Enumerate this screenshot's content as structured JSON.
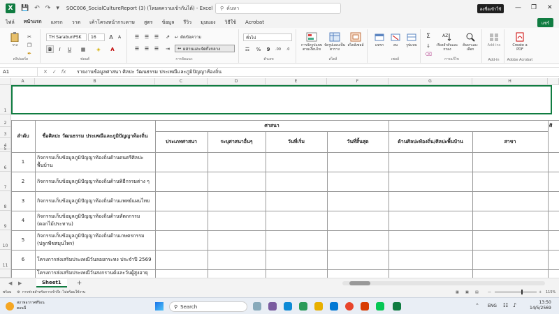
{
  "titlebar": {
    "autosave_label": "",
    "doc_title": "SOC006_SocialCultureReport (3) (โหมดความเข้ากันได้) - Excel",
    "search_placeholder": "ค้นหา",
    "signin_label": "ลงชื่อเข้าใช้"
  },
  "tabs": [
    "ไฟล์",
    "หน้าแรก",
    "แทรก",
    "วาด",
    "เค้าโครงหน้ากระดาษ",
    "สูตร",
    "ข้อมูล",
    "รีวิว",
    "มุมมอง",
    "วิธีใช้",
    "Acrobat"
  ],
  "active_tab": "หน้าแรก",
  "share_label": "แชร์",
  "ribbon": {
    "paste_label": "วาง",
    "clipboard_label": "คลิปบอร์ด",
    "font_name": "TH SarabunPSK",
    "font_size": "16",
    "font_group_label": "ฟอนต์",
    "wrap_text_label": "ตัดข้อความ",
    "merge_label": "ผสานและจัดกึ่งกลาง",
    "align_group_label": "การจัดแนว",
    "number_format": "ทั่วไป",
    "number_group_label": "ตัวเลข",
    "cond_format_label": "การจัดรูปแบบตามเงื่อนไข",
    "format_table_label": "จัดรูปแบบเป็นตาราง",
    "cell_styles_label": "สไตล์เซลล์",
    "styles_group_label": "สไตล์",
    "insert_label": "แทรก",
    "delete_label": "ลบ",
    "format_label": "รูปแบบ",
    "cells_group_label": "เซลล์",
    "sort_label": "เรียงลำดับและกรอง",
    "find_label": "ค้นหาและเลือก",
    "editing_group_label": "การแก้ไข",
    "addins_label": "Add-ins",
    "addin_group_label": "Add-in",
    "create_pdf_label": "Create a PDF",
    "acrobat_group_label": "Adobe Acrobat"
  },
  "formula_bar": {
    "name_box": "A1",
    "content": "รายงานข้อมูลศาสนา ศิลปะ วัฒนธรรม ประเพณีและภูมิปัญญาท้องถิ่น"
  },
  "columns": [
    "A",
    "B",
    "C",
    "D",
    "E",
    "F",
    "G",
    "H"
  ],
  "rows": [
    "1",
    "2",
    "3",
    "4",
    "5",
    "6",
    "7",
    "8",
    "9",
    "10",
    "11"
  ],
  "headers": {
    "seq": "ลำดับ",
    "name": "ชื่อศิลปะ วัฒนธรรม ประเพณีและภูมิปัญญาท้องถิ่น",
    "religion": "ศาสนา",
    "religion_type": "ประเภทศาสนา",
    "other": "ระบุศาสนาอื่นๆ",
    "start": "วันที่เริ่ม",
    "end": "วันที่สิ้นสุด",
    "art_local": "ด้านศิลปะท้องถิ่น/ศิลปะพื้นบ้าน",
    "branch": "สาขา",
    "cut": "ศิ"
  },
  "table_rows": [
    {
      "no": "1",
      "line1": "กิจกรรมเก็บข้อมูลภูมิปัญญาท้องถิ่นด้านดนตรีศิลปะ",
      "line2": "พื้นบ้าน"
    },
    {
      "no": "2",
      "line1": "กิจกรรมเก็บข้อมูลภูมิปัญญาท้องถิ่นด้านพิธีกรรมต่าง ๆ",
      "line2": ""
    },
    {
      "no": "3",
      "line1": "กิจกรรมเก็บข้อมูลภูมิปัญญาท้องถิ่นด้านแพทย์แผนไทย",
      "line2": ""
    },
    {
      "no": "4",
      "line1": "กิจกรรมเก็บข้อมูลภูมิปัญญาท้องถิ่นด้านหัตถกรรม",
      "line2": "(ดอกไม้ประทาน)"
    },
    {
      "no": "5",
      "line1": "กิจกรรมเก็บข้อมูลภูมิปัญญาท้องถิ่นด้านเกษตรกรรม",
      "line2": "(ปลูกพืชสมุนไพร)"
    },
    {
      "no": "6",
      "line1": "โครงการส่งเสริมประเพณีวันลอยกระทง ประจำปี 2569",
      "line2": ""
    },
    {
      "no": "",
      "line1": "โครงการส่งเสริมประเพณีวันสงกรานต์และวันผู้สูงอายุ ประจำปี",
      "line2": ""
    }
  ],
  "sheet_tab": "Sheet1",
  "status": {
    "ready": "พร้อม",
    "accessibility": "การช่วยสำหรับการเข้าถึง: ไม่พร้อมใช้งาน",
    "zoom": "115%"
  },
  "taskbar": {
    "weather_line1": "สภาพอากาศที่ร้อน",
    "weather_line2": "ตอนนี้",
    "search_label": "Search",
    "lang": "ENG",
    "time": "13:50",
    "date": "14/5/2569"
  }
}
